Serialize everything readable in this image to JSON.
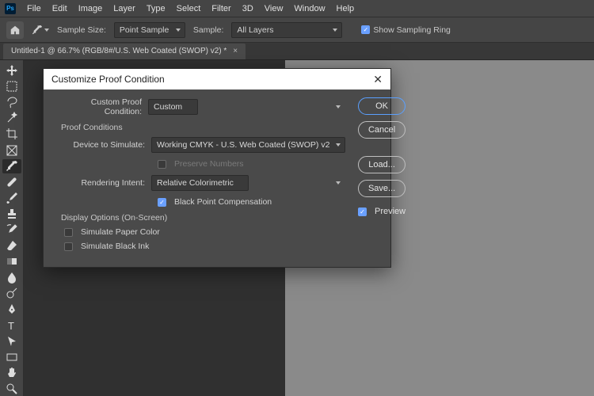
{
  "menu": {
    "items": [
      "File",
      "Edit",
      "Image",
      "Layer",
      "Type",
      "Select",
      "Filter",
      "3D",
      "View",
      "Window",
      "Help"
    ]
  },
  "options": {
    "sample_size_label": "Sample Size:",
    "sample_size_value": "Point Sample",
    "sample_label": "Sample:",
    "sample_value": "All Layers",
    "show_sampling_ring": "Show Sampling Ring"
  },
  "doc_tab": {
    "title": "Untitled-1 @ 66.7% (RGB/8#/U.S. Web Coated (SWOP) v2) *"
  },
  "dialog": {
    "title": "Customize Proof Condition",
    "condition_label": "Custom Proof Condition:",
    "condition_value": "Custom",
    "proof_conditions_header": "Proof Conditions",
    "device_label": "Device to Simulate:",
    "device_value": "Working CMYK - U.S. Web Coated (SWOP) v2",
    "preserve_numbers": "Preserve Numbers",
    "rendering_label": "Rendering Intent:",
    "rendering_value": "Relative Colorimetric",
    "black_point": "Black Point Compensation",
    "display_options_header": "Display Options (On-Screen)",
    "simulate_paper": "Simulate Paper Color",
    "simulate_ink": "Simulate Black Ink",
    "buttons": {
      "ok": "OK",
      "cancel": "Cancel",
      "load": "Load...",
      "save": "Save..."
    },
    "preview": "Preview"
  },
  "tools": [
    "move",
    "marquee",
    "lasso",
    "wand",
    "crop",
    "frame",
    "eyedropper",
    "heal",
    "brush",
    "stamp",
    "history",
    "eraser",
    "gradient",
    "blur",
    "dodge",
    "pen",
    "type",
    "path",
    "rectangle",
    "hand",
    "zoom"
  ]
}
